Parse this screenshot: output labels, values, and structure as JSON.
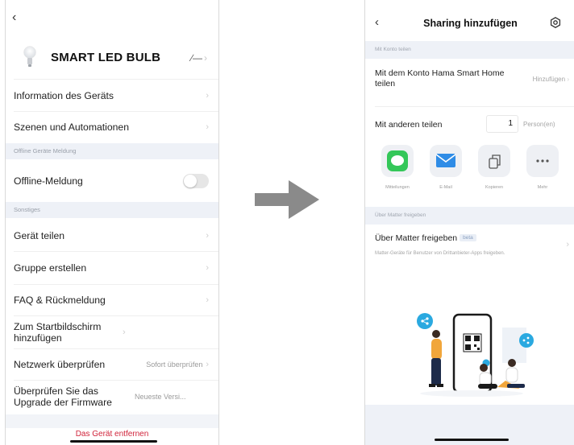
{
  "left_screen": {
    "device_name": "SMART LED BULB",
    "rows": {
      "info": "Information des Geräts",
      "scenes": "Szenen und Automationen",
      "offline_section": "Offline Geräte Meldung",
      "offline_label": "Offline-Meldung",
      "offline_enabled": false,
      "misc_section": "Sonstiges",
      "share": "Gerät teilen",
      "group": "Gruppe erstellen",
      "faq": "FAQ & Rückmeldung",
      "homescreen": "Zum Startbildschirm hinzufügen",
      "network": "Netzwerk überprüfen",
      "network_value": "Sofort überprüfen",
      "firmware": "Überprüfen Sie das Upgrade der Firmware",
      "firmware_value": "Neueste Versi..."
    },
    "remove_device": "Das Gerät entfernen"
  },
  "right_screen": {
    "title": "Sharing hinzufügen",
    "account_section": "Mit Konto teilen",
    "account_row": "Mit dem Konto Hama Smart Home teilen",
    "account_action": "Hinzufügen",
    "others_label": "Mit anderen teilen",
    "count": "1",
    "count_unit": "Person(en)",
    "apps": [
      {
        "label": "Mitteilungen",
        "icon": "message-icon",
        "color": "#34c759"
      },
      {
        "label": "E-Mail",
        "icon": "mail-icon",
        "color": "#2f8ce6"
      },
      {
        "label": "Kopieren",
        "icon": "copy-icon",
        "color": "#555555"
      },
      {
        "label": "Mehr",
        "icon": "more-icon",
        "color": "#555555"
      }
    ],
    "matter_section": "Über Matter freigeben",
    "matter_title": "Über Matter freigeben",
    "matter_badge": "beta",
    "matter_desc": "Matter-Geräte für Benutzer von Drittanbieter-Apps freigeben."
  },
  "colors": {
    "accent": "#2aa9e0",
    "danger": "#d0233a",
    "section_bg": "#eef1f7",
    "arrow": "#8a8a8a"
  }
}
